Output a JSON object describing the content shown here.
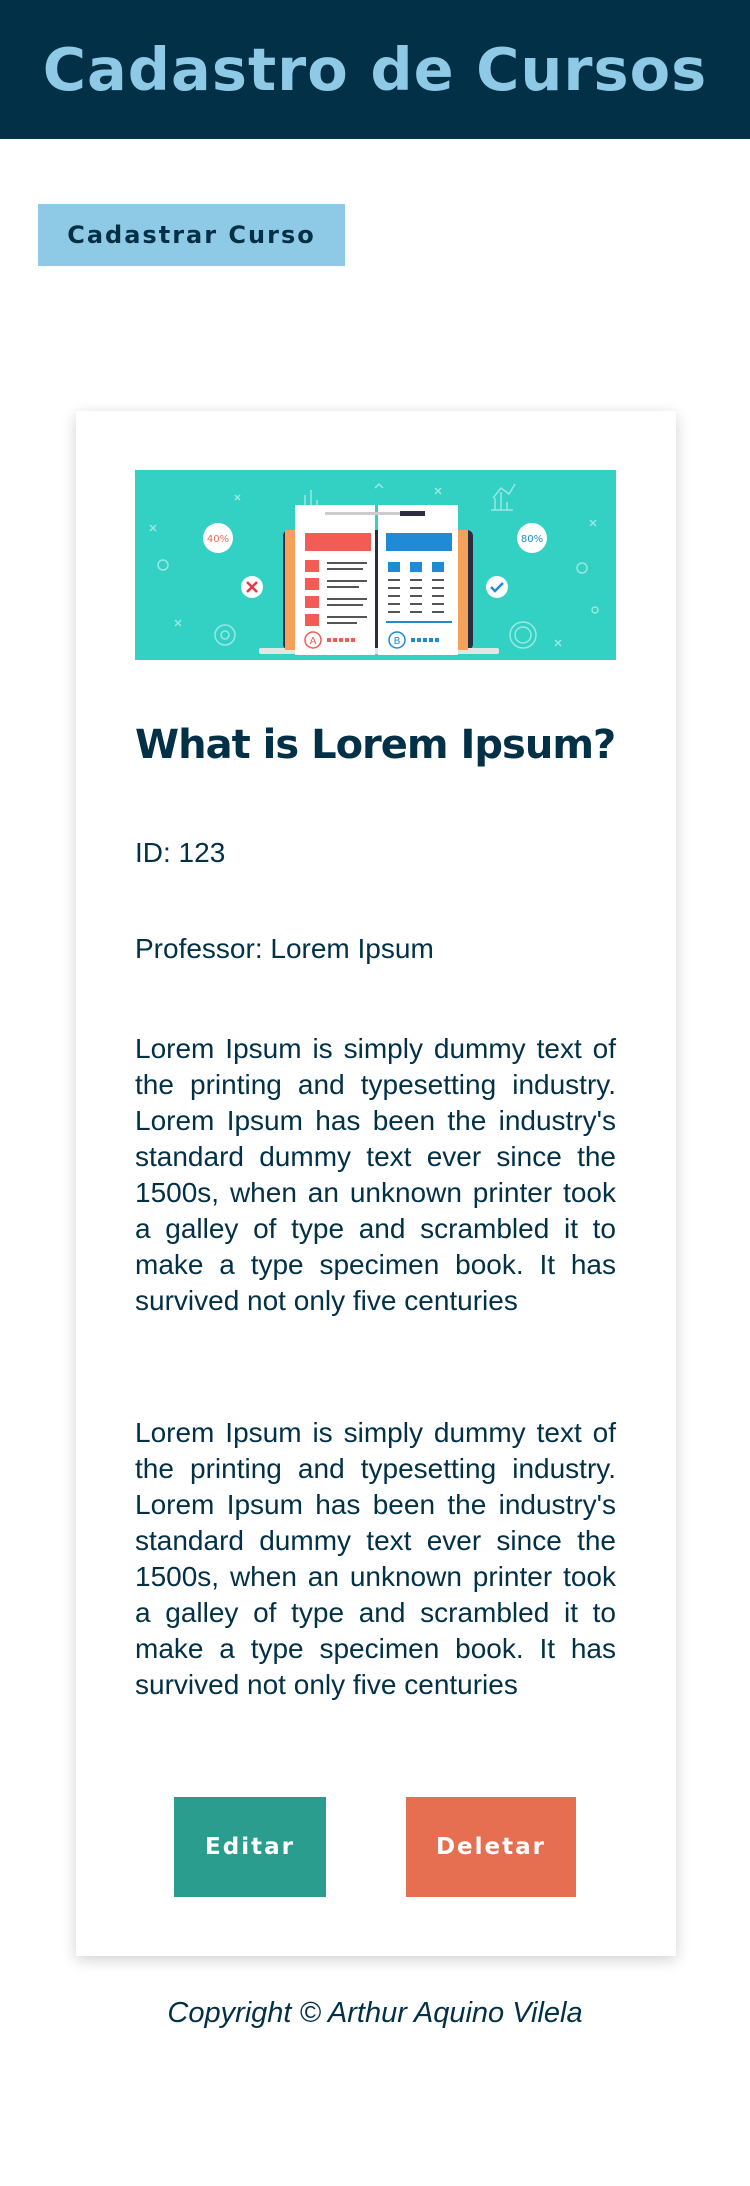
{
  "header": {
    "title": "Cadastro de Cursos"
  },
  "actions": {
    "register_label": "Cadastrar Curso"
  },
  "course": {
    "image_icon": "online-course-illustration",
    "image_badges": [
      "40%",
      "80%",
      "A",
      "B"
    ],
    "title": "What is Lorem Ipsum?",
    "id_label": "ID: 123",
    "professor_label": "Professor: Lorem Ipsum",
    "description_1": "Lorem Ipsum is simply dummy text of the printing and typesetting industry. Lorem Ipsum has been the industry's standard dummy text ever since the 1500s, when an unknown printer took a galley of type and scrambled it to make a type specimen book. It has survived not only five centuries",
    "description_2": "Lorem Ipsum is simply dummy text of the printing and typesetting industry. Lorem Ipsum has been the industry's standard dummy text ever since the 1500s, when an unknown printer took a galley of type and scrambled it to make a type specimen book. It has survived not only five centuries",
    "edit_label": "Editar",
    "delete_label": "Deletar"
  },
  "footer": {
    "copyright": "Copyright © Arthur Aquino Vilela"
  },
  "colors": {
    "navy": "#023047",
    "light_blue": "#8ecae6",
    "teal": "#2a9d8f",
    "coral": "#e76f51",
    "banner_teal": "#33d1c4"
  }
}
